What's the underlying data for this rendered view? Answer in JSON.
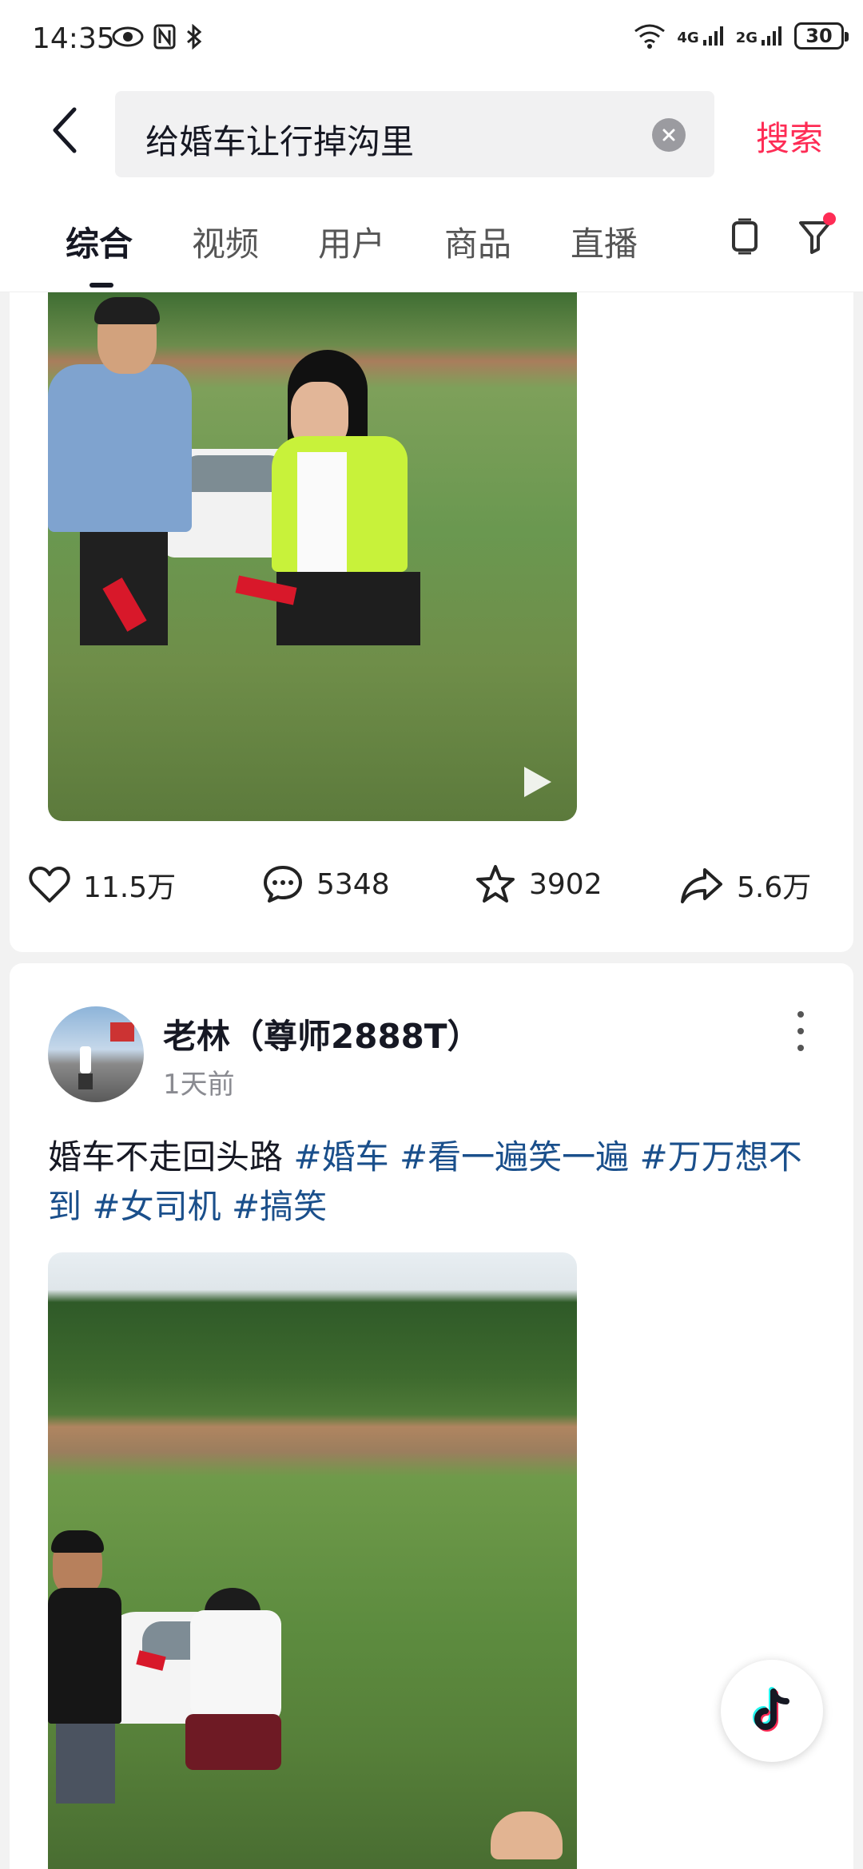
{
  "status_bar": {
    "time": "14:35",
    "battery": "30",
    "network_1": "4G",
    "network_2": "2G",
    "icons": [
      "eye-icon",
      "nfc-icon",
      "bluetooth-icon",
      "wifi-icon",
      "signal-icon"
    ]
  },
  "header": {
    "back_icon": "chevron-left-icon",
    "search_value": "给婚车让行掉沟里",
    "clear_icon": "clear-icon",
    "search_label": "搜索"
  },
  "tabs": {
    "items": [
      "综合",
      "视频",
      "用户",
      "商品",
      "直播"
    ],
    "active_index": 0,
    "icons": [
      "tablet-icon",
      "filter-icon"
    ]
  },
  "post1": {
    "stats": {
      "likes": "11.5万",
      "comments": "5348",
      "favorites": "3902",
      "shares": "5.6万"
    }
  },
  "post2": {
    "author": "老林（尊师2888T）",
    "time": "1天前",
    "text": "婚车不走回头路",
    "tags": [
      "#婚车",
      "#看一遍笑一遍",
      "#万万想不到",
      "#女司机",
      "#搞笑"
    ]
  },
  "colors": {
    "accent": "#fe2c55",
    "tag": "#1a4f8b",
    "text": "#161823"
  },
  "fab_icon": "tiktok-logo-icon"
}
